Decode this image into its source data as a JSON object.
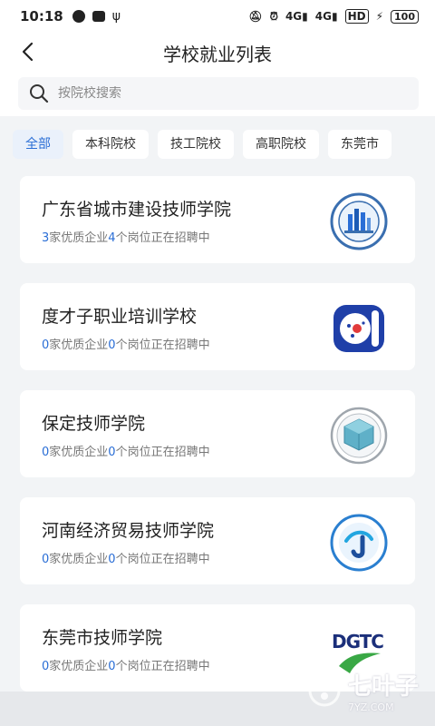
{
  "status_bar": {
    "time": "10:18",
    "signal_1": "4G",
    "signal_2": "4G",
    "hd": "HD",
    "battery": "100"
  },
  "header": {
    "title": "学校就业列表"
  },
  "search": {
    "placeholder": "按院校搜索"
  },
  "tabs": [
    {
      "label": "全部",
      "active": true
    },
    {
      "label": "本科院校"
    },
    {
      "label": "技工院校"
    },
    {
      "label": "高职院校"
    },
    {
      "label": "东莞市"
    }
  ],
  "schools": [
    {
      "name": "广东省城市建设技师学院",
      "companies": "3",
      "companies_suffix": "家优质企业",
      "positions": "4",
      "positions_suffix": "个岗位正在招聘中"
    },
    {
      "name": "度才子职业培训学校",
      "companies": "0",
      "companies_suffix": "家优质企业",
      "positions": "0",
      "positions_suffix": "个岗位正在招聘中"
    },
    {
      "name": "保定技师学院",
      "companies": "0",
      "companies_suffix": "家优质企业",
      "positions": "0",
      "positions_suffix": "个岗位正在招聘中"
    },
    {
      "name": "河南经济贸易技师学院",
      "companies": "0",
      "companies_suffix": "家优质企业",
      "positions": "0",
      "positions_suffix": "个岗位正在招聘中"
    },
    {
      "name": "东莞市技师学院",
      "companies": "0",
      "companies_suffix": "家优质企业",
      "positions": "0",
      "positions_suffix": "个岗位正在招聘中"
    }
  ],
  "logos": {
    "dgtc": "DGTC"
  },
  "watermark": {
    "text": "七叶子",
    "sub": "7YZ.COM"
  },
  "colors": {
    "accent": "#2a6ed6",
    "background": "#f2f4f6"
  }
}
